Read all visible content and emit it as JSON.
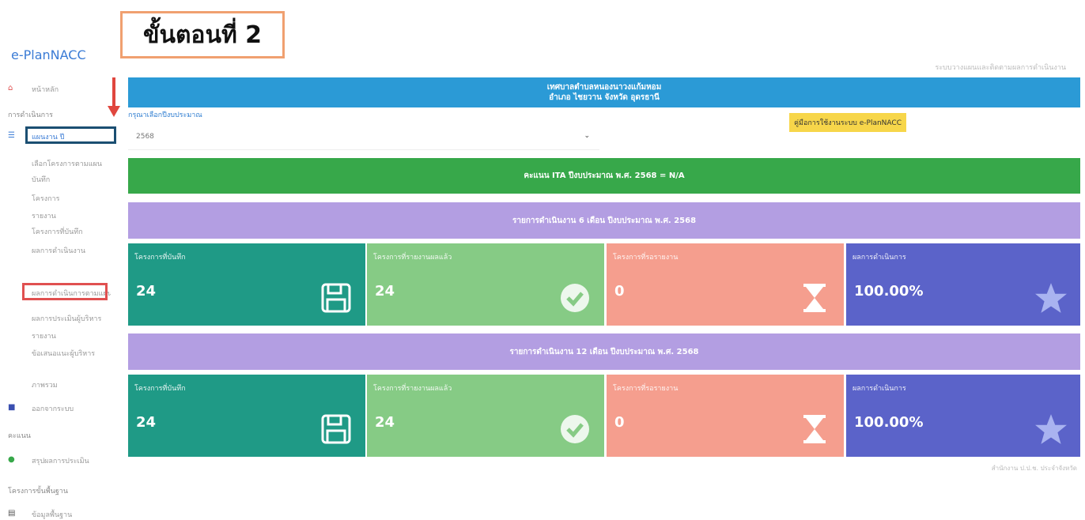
{
  "app": {
    "brand": "e-PlanNACC",
    "step_label": "ขั้นตอนที่ 2",
    "top_right_text": "ระบบวางแผนและติดตามผลการดำเนินงาน"
  },
  "sidebar": {
    "items": [
      {
        "label": "หน้าหลัก"
      },
      {
        "label": "การดำเนินการ",
        "heading": true
      },
      {
        "label": "แผนงาน ปี",
        "active": true
      },
      {
        "label": "เลือกโครงการตามแผน"
      },
      {
        "label": "บันทึก"
      },
      {
        "label": "โครงการ"
      },
      {
        "label": "รายงาน"
      },
      {
        "label": "โครงการที่บันทึก"
      },
      {
        "label": "ผลการดำเนินงาน"
      },
      {
        "label": "ผลการดำเนินการตามแผน",
        "highlight": true
      },
      {
        "label": "ผลการประเมินผู้บริหาร"
      },
      {
        "label": "รายงาน"
      },
      {
        "label": "ข้อเสนอแนะผู้บริหาร"
      },
      {
        "label": "ภาพรวม"
      },
      {
        "label": "ออกจากระบบ"
      },
      {
        "label": "คะแนน",
        "heading": true
      },
      {
        "label": "สรุปผลการประเมิน"
      },
      {
        "label": "โครงการขั้นพื้นฐาน",
        "heading": true
      },
      {
        "label": "ข้อมูลพื้นฐาน"
      }
    ]
  },
  "header": {
    "org_line1": "เทศบาลตำบลหนองนาวงแก้มหอม",
    "org_line2": "อำเภอ ไชยวาน จังหวัด อุดรธานี"
  },
  "year_select": {
    "label": "กรุณาเลือกปีงบประมาณ",
    "value": "2568"
  },
  "manual_button": {
    "label": "คู่มือการใช้งานระบบ e-PlanNACC"
  },
  "ita_band": {
    "text": "คะแนน ITA ปีงบประมาณ พ.ศ. 2568 = N/A"
  },
  "section_6m": {
    "title": "รายการดำเนินงาน 6 เดือน ปีงบประมาณ พ.ศ. 2568",
    "cards": [
      {
        "label": "โครงการที่บันทึก",
        "value": "24",
        "icon": "save-icon"
      },
      {
        "label": "โครงการที่รายงานผลแล้ว",
        "value": "24",
        "icon": "check-icon"
      },
      {
        "label": "โครงการที่รอรายงาน",
        "value": "0",
        "icon": "hourglass-icon"
      },
      {
        "label": "ผลการดำเนินการ",
        "value": "100.00%",
        "icon": "star-icon"
      }
    ]
  },
  "section_12m": {
    "title": "รายการดำเนินงาน 12 เดือน ปีงบประมาณ พ.ศ. 2568",
    "cards": [
      {
        "label": "โครงการที่บันทึก",
        "value": "24",
        "icon": "save-icon"
      },
      {
        "label": "โครงการที่รายงานผลแล้ว",
        "value": "24",
        "icon": "check-icon"
      },
      {
        "label": "โครงการที่รอรายงาน",
        "value": "0",
        "icon": "hourglass-icon"
      },
      {
        "label": "ผลการดำเนินการ",
        "value": "100.00%",
        "icon": "star-icon"
      }
    ]
  },
  "footnote": "สำนักงาน ป.ป.ช. ประจำจังหวัด",
  "colors": {
    "blue": "#2b9ad6",
    "green": "#37a84a",
    "purple": "#b39ee2",
    "teal": "#1f9a86",
    "light_green": "#86cb85",
    "salmon": "#f59e8e",
    "indigo": "#5b63c9",
    "manual_yellow": "#f7d64a"
  }
}
